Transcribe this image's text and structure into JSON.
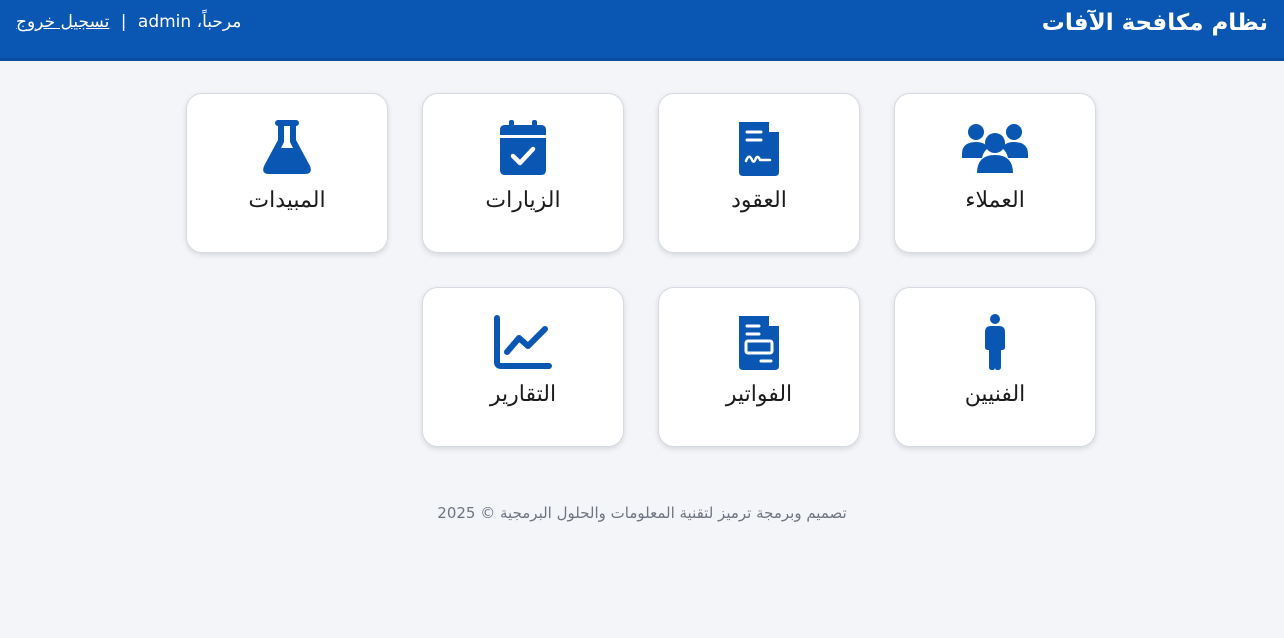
{
  "header": {
    "title": "نظام مكافحة الآفات",
    "greeting": "مرحباً، admin",
    "separator": "|",
    "logout_label": "تسجيل خروج"
  },
  "cards": [
    {
      "label": "العملاء",
      "icon": "users-icon"
    },
    {
      "label": "العقود",
      "icon": "contract-file-icon"
    },
    {
      "label": "الزيارات",
      "icon": "calendar-check-icon"
    },
    {
      "label": "المبيدات",
      "icon": "flask-icon"
    },
    {
      "label": "الفنيين",
      "icon": "person-icon"
    },
    {
      "label": "الفواتير",
      "icon": "invoice-icon"
    },
    {
      "label": "التقارير",
      "icon": "chart-line-icon"
    }
  ],
  "footer": {
    "text": "تصميم وبرمجة ترميز لتقنية المعلومات والحلول البرمجية © 2025"
  },
  "colors": {
    "primary": "#0a57b3",
    "background": "#f3f5f9",
    "card_background": "#ffffff",
    "icon": "#0a57b3"
  }
}
